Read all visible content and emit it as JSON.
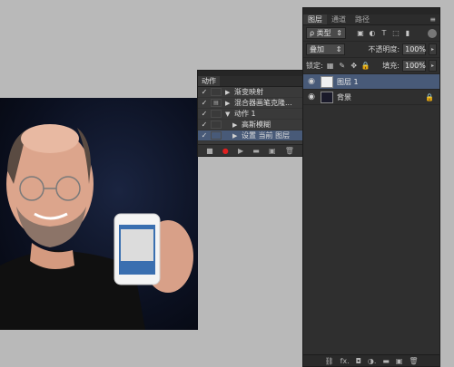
{
  "actions_panel": {
    "tab": "动作",
    "rows": [
      {
        "check": "✓",
        "dialog": "",
        "tri": "▶",
        "label": "渐变映射",
        "selected": false
      },
      {
        "check": "✓",
        "dialog": "▤",
        "tri": "▶",
        "label": "混合器画笔克隆...",
        "selected": false
      },
      {
        "check": "✓",
        "dialog": "",
        "tri": "▼",
        "label": "动作 1",
        "selected": false
      },
      {
        "check": "✓",
        "dialog": "",
        "tri": "▶",
        "label": "高斯模糊",
        "selected": false
      },
      {
        "check": "✓",
        "dialog": "",
        "tri": "▶",
        "label": "设置 当前 图层",
        "selected": true
      }
    ],
    "footer": [
      "■",
      "●",
      "▶",
      "▬",
      "▣",
      "🗑"
    ]
  },
  "layers_panel": {
    "tabs": [
      "图层",
      "通道",
      "路径"
    ],
    "menu_icon": "≡",
    "filter": {
      "label": "ρ 类型",
      "arrow": "⇕",
      "icons": [
        "▣",
        "◐",
        "T",
        "⬚",
        "▮"
      ]
    },
    "blend_mode": "叠加",
    "opacity_label": "不透明度:",
    "opacity_value": "100%",
    "lock_label": "锁定:",
    "lock_icons": [
      "▦",
      "✎",
      "✥",
      "🔒"
    ],
    "fill_label": "填充:",
    "fill_value": "100%",
    "layers": [
      {
        "name": "图层 1",
        "selected": true,
        "locked": false,
        "thumb": "light"
      },
      {
        "name": "背景",
        "selected": false,
        "locked": true,
        "thumb": "dark"
      }
    ],
    "footer": [
      "⛓",
      "fx.",
      "◘",
      "◑.",
      "▬",
      "▣",
      "🗑"
    ]
  },
  "colors": {
    "panel": "#2f2f2f",
    "selection": "#485a78",
    "workspace": "#b9b9b9"
  }
}
